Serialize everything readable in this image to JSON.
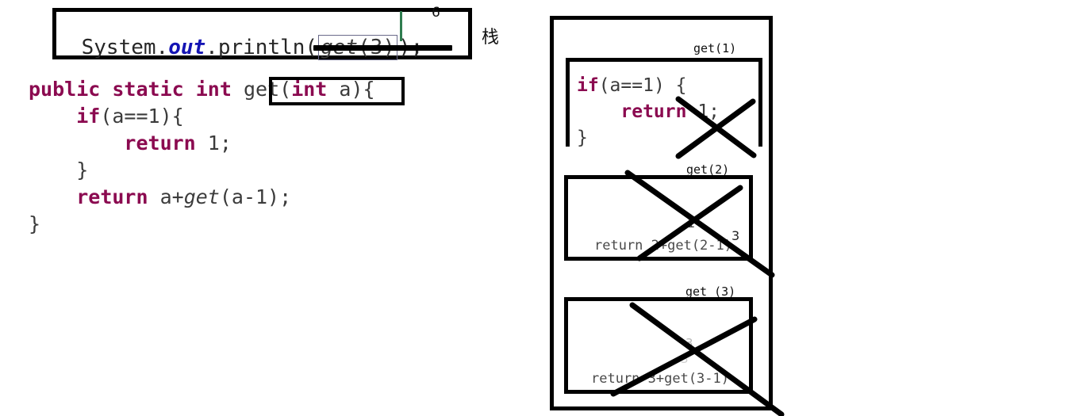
{
  "code_box": {
    "line_prefix": "System.",
    "out_token": "out",
    "line_mid": ".println(",
    "boxed_call_italic": "get",
    "boxed_call_args": "(3)",
    "line_suffix": ");",
    "result_superscript": "6",
    "caret": "|",
    "underline": "solid-black-underline",
    "side_label": "栈"
  },
  "method_source": {
    "lines": [
      {
        "indent": 0,
        "tokens": [
          {
            "t": "public",
            "k": "kw"
          },
          {
            "t": " ",
            "k": "id"
          },
          {
            "t": "static",
            "k": "kw"
          },
          {
            "t": " ",
            "k": "id"
          },
          {
            "t": "int",
            "k": "kw"
          },
          {
            "t": " ",
            "k": "id"
          },
          {
            "t": "get(",
            "k": "id"
          },
          {
            "t": "int",
            "k": "kw"
          },
          {
            "t": " a)",
            "k": "id"
          },
          {
            "t": "{",
            "k": "id"
          }
        ]
      },
      {
        "indent": 1,
        "tokens": [
          {
            "t": "if",
            "k": "kw"
          },
          {
            "t": "(a==1){",
            "k": "id"
          }
        ]
      },
      {
        "indent": 2,
        "tokens": [
          {
            "t": "return",
            "k": "kw"
          },
          {
            "t": " 1;",
            "k": "id"
          }
        ]
      },
      {
        "indent": 1,
        "tokens": [
          {
            "t": "}",
            "k": "id"
          }
        ]
      },
      {
        "indent": 1,
        "tokens": [
          {
            "t": "return",
            "k": "kw"
          },
          {
            "t": " a+",
            "k": "id"
          },
          {
            "t": "get",
            "k": "ital"
          },
          {
            "t": "(a-1);",
            "k": "id"
          }
        ]
      },
      {
        "indent": 0,
        "tokens": [
          {
            "t": "}",
            "k": "id"
          }
        ]
      }
    ],
    "signature_highlight": "get(int a)"
  },
  "stack": {
    "container_label": "call-stack",
    "frames": [
      {
        "label": "get(1)",
        "body_lines": [
          {
            "indent": 0,
            "tokens": [
              {
                "t": "if",
                "k": "kw"
              },
              {
                "t": "(a==1) {",
                "k": "id"
              }
            ]
          },
          {
            "indent": 1,
            "tokens": [
              {
                "t": "return",
                "k": "kw"
              },
              {
                "t": " 1;",
                "k": "id"
              }
            ]
          },
          {
            "indent": 0,
            "tokens": [
              {
                "t": "}",
                "k": "id"
              }
            ]
          }
        ],
        "annotations": [],
        "struck_out": true,
        "open_bottom": true
      },
      {
        "label": "get(2)",
        "body_text": "return 2+get(2-1)",
        "annotations": [
          "1",
          "3"
        ],
        "struck_out": true,
        "open_bottom": false
      },
      {
        "label": "get (3)",
        "body_text": "return 3+get(3-1)",
        "annotations": [
          "3",
          "3"
        ],
        "struck_out": true,
        "open_bottom": false
      }
    ]
  },
  "colors": {
    "keyword": "#8b0a50",
    "out_keyword": "#1414b4",
    "ink": "#000000",
    "identifier": "#3b3b3b",
    "caret": "#2f7d4f",
    "call_box_border": "#6a6a8a"
  }
}
